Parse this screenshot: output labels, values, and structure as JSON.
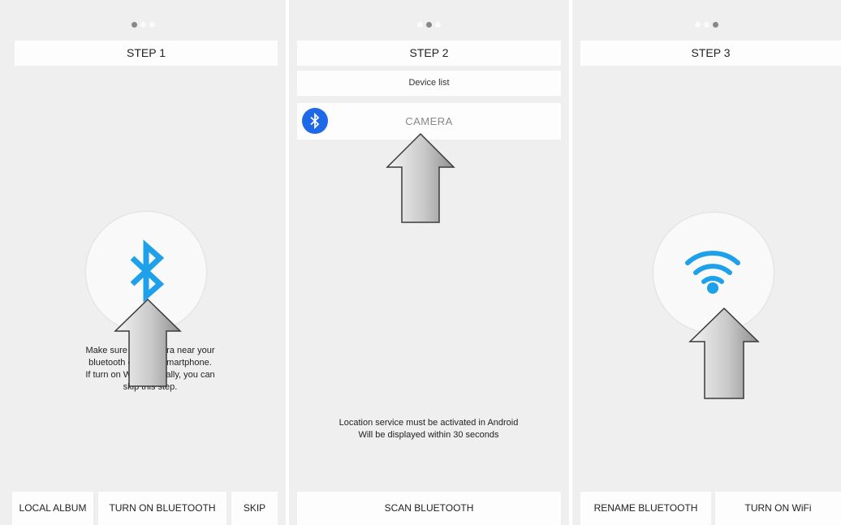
{
  "step1": {
    "title": "STEP 1",
    "message": [
      "Make sure the camera near your",
      "bluetooth enabled smartphone.",
      "If turn on WiFi manually, you can",
      "skip this step."
    ],
    "buttons": {
      "local_album": "LOCAL ALBUM",
      "turn_on_bluetooth": "TURN ON BLUETOOTH",
      "skip": "SKIP"
    },
    "icon": "bluetooth-icon"
  },
  "step2": {
    "title": "STEP 2",
    "device_list_label": "Device list",
    "devices": [
      {
        "name": "CAMERA",
        "icon": "bluetooth-icon"
      }
    ],
    "message": [
      "Location service must be activated in Android",
      "Will be displayed within 30 seconds"
    ],
    "buttons": {
      "scan_bluetooth": "SCAN BLUETOOTH"
    }
  },
  "step3": {
    "title": "STEP 3",
    "buttons": {
      "rename_bluetooth": "RENAME BLUETOOTH",
      "turn_on_wifi": "TURN ON WiFi"
    },
    "icon": "wifi-icon"
  },
  "colors": {
    "accent_blue": "#1ea1ea",
    "badge_blue": "#1f68e8",
    "background": "#efefef"
  }
}
